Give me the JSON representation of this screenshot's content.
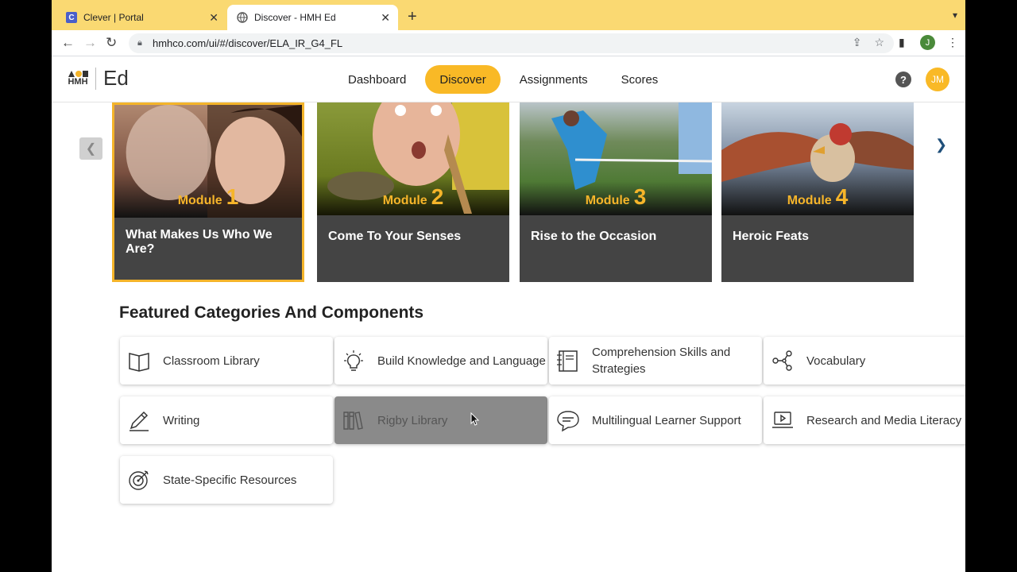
{
  "browser": {
    "tabs": [
      {
        "title": "Clever | Portal",
        "favicon": "C"
      },
      {
        "title": "Discover - HMH Ed"
      }
    ],
    "url": "hmhco.com/ui/#/discover/ELA_IR_G4_FL",
    "profile_initial": "J"
  },
  "app": {
    "logo_mark": "HMH",
    "logo_product": "Ed",
    "nav": [
      "Dashboard",
      "Discover",
      "Assignments",
      "Scores"
    ],
    "active_nav": "Discover",
    "help": "?",
    "user_initials": "JM"
  },
  "modules": [
    {
      "label": "Module",
      "number": "1",
      "title": "What Makes Us Who We Are?",
      "selected": true
    },
    {
      "label": "Module",
      "number": "2",
      "title": "Come To Your Senses",
      "selected": false
    },
    {
      "label": "Module",
      "number": "3",
      "title": "Rise to the Occasion",
      "selected": false
    },
    {
      "label": "Module",
      "number": "4",
      "title": "Heroic Feats",
      "selected": false
    }
  ],
  "featured": {
    "heading": "Featured Categories And Components",
    "items": [
      {
        "label": "Classroom Library",
        "icon": "book-icon"
      },
      {
        "label": "Build Knowledge and Language",
        "icon": "lightbulb-icon"
      },
      {
        "label": "Comprehension Skills and Strategies",
        "icon": "notebook-icon"
      },
      {
        "label": "Vocabulary",
        "icon": "share-nodes-icon"
      },
      {
        "label": "Writing",
        "icon": "pencil-icon"
      },
      {
        "label": "Rigby Library",
        "icon": "bookshelf-icon"
      },
      {
        "label": "Multilingual Learner Support",
        "icon": "speech-bubble-icon"
      },
      {
        "label": "Research and Media Literacy",
        "icon": "laptop-play-icon"
      },
      {
        "label": "State-Specific Resources",
        "icon": "target-icon"
      }
    ],
    "hovered": "Rigby Library"
  },
  "colors": {
    "accent": "#f9b926",
    "chrome": "#fad972",
    "card": "#444444"
  }
}
